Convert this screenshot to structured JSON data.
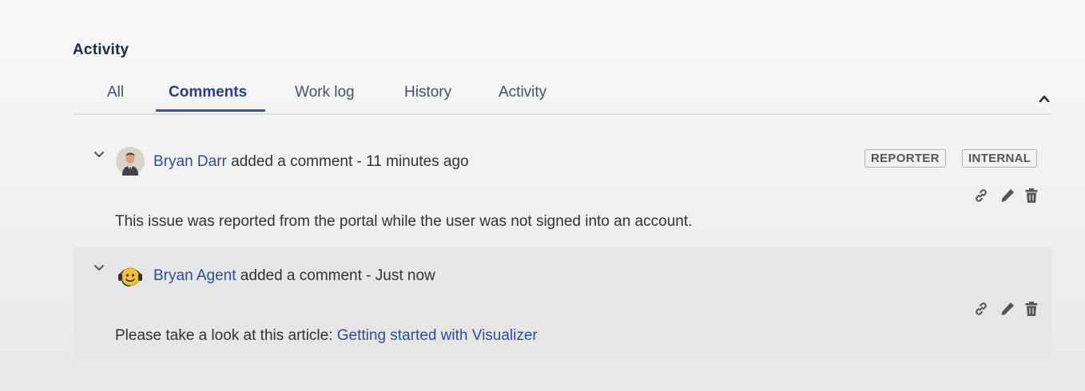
{
  "activity": {
    "title": "Activity",
    "tabs": [
      {
        "label": "All",
        "active": false
      },
      {
        "label": "Comments",
        "active": true
      },
      {
        "label": "Work log",
        "active": false
      },
      {
        "label": "History",
        "active": false
      },
      {
        "label": "Activity",
        "active": false
      }
    ],
    "collapse_icon": "caret-up-icon"
  },
  "comments": [
    {
      "author": "Bryan Darr",
      "action_text": " added a comment - 11 minutes ago",
      "avatar_icon": "user-photo-avatar",
      "badges": [
        "REPORTER",
        "INTERNAL"
      ],
      "body_text": "This issue was reported from the portal while the user was not signed into an account.",
      "actions": [
        "link-icon",
        "edit-icon",
        "delete-icon"
      ]
    },
    {
      "author": "Bryan Agent",
      "action_text": " added a comment - Just now",
      "avatar_icon": "agent-headset-avatar",
      "badges": [],
      "body_text": "Please take a look at this article: ",
      "body_link": "Getting started with Visualizer",
      "actions": [
        "link-icon",
        "edit-icon",
        "delete-icon"
      ]
    }
  ],
  "colors": {
    "link": "#2c4f94",
    "active_tab": "#25408f",
    "tab_underline": "#2a55b0",
    "highlight_row": "#e6e6e6"
  }
}
